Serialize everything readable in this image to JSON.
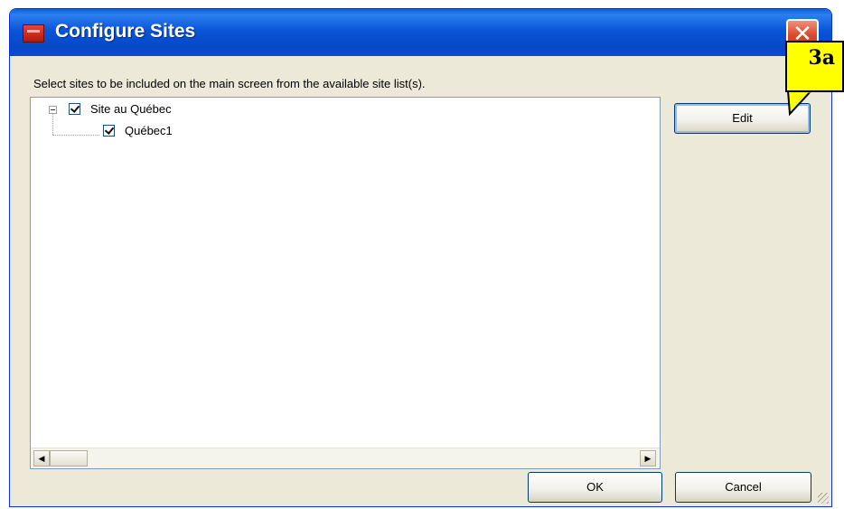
{
  "window": {
    "title": "Configure Sites",
    "close_glyph": "✕",
    "instruction": "Select sites to be included on the main screen from the available site list(s)."
  },
  "tree": {
    "items": [
      {
        "label": "Site au Québec",
        "checked": true,
        "expanded": true,
        "level": 0
      },
      {
        "label": "Québec1",
        "checked": true,
        "level": 1
      }
    ]
  },
  "scrollbar": {
    "left_arrow": "◀",
    "right_arrow": "▶"
  },
  "buttons": {
    "edit": "Edit",
    "ok": "OK",
    "cancel": "Cancel"
  },
  "callout": {
    "label": "3a",
    "color": "#ffff00"
  },
  "colors": {
    "titlebar": "#0a55d8",
    "window_bg": "#ece9d8",
    "close": "#d9482c"
  },
  "icons": [
    "app-icon",
    "close-icon",
    "expander-icon",
    "checkbox-icon",
    "scroll-left-icon",
    "scroll-right-icon",
    "resize-grip-icon"
  ]
}
